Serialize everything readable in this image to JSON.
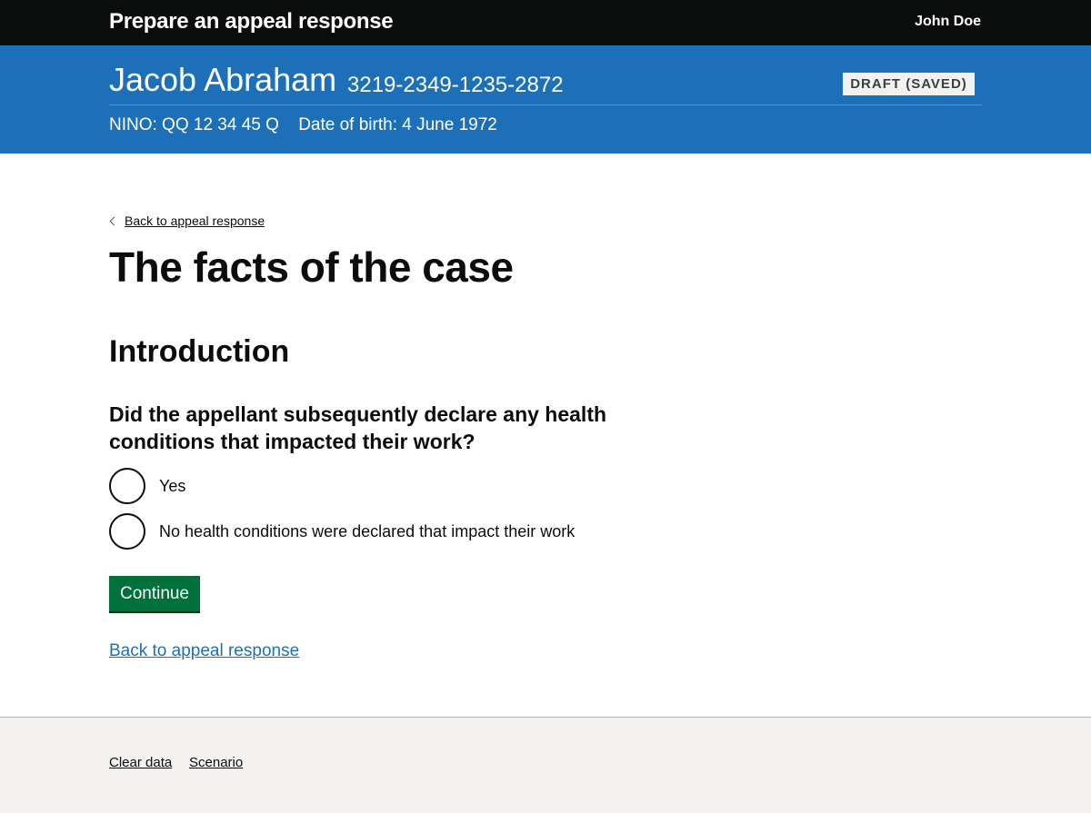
{
  "header": {
    "service_name": "Prepare an appeal response",
    "user_name": "John Doe"
  },
  "case": {
    "name": "Jacob Abraham",
    "reference": "3219-2349-1235-2872",
    "status": "DRAFT (SAVED)",
    "nino": "NINO: QQ 12 34 45 Q",
    "dob": "Date of birth: 4 June 1972"
  },
  "main": {
    "back_link_top": "Back to appeal response",
    "title": "The facts of the case",
    "section_heading": "Introduction",
    "question": "Did the appellant subsequently declare any health conditions that impacted their work?",
    "options": [
      {
        "label": "Yes",
        "selected": false
      },
      {
        "label": "No health conditions were declared that impact their work",
        "selected": false
      }
    ],
    "continue_label": "Continue",
    "back_link_bottom": "Back to appeal response"
  },
  "footer": {
    "links": [
      "Clear data",
      "Scenario"
    ]
  }
}
